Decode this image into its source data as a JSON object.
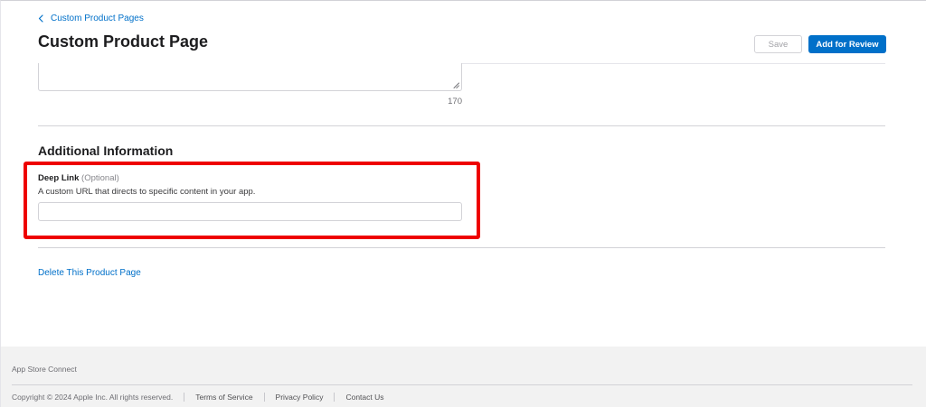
{
  "breadcrumb": {
    "back_label": "Custom Product Pages"
  },
  "header": {
    "title": "Custom Product Page",
    "save_label": "Save",
    "review_label": "Add for Review"
  },
  "promo_text": {
    "char_count": "170"
  },
  "additional_info": {
    "title": "Additional Information",
    "deep_link": {
      "label": "Deep Link",
      "optional": "(Optional)",
      "description": "A custom URL that directs to specific content in your app.",
      "value": "",
      "placeholder": ""
    }
  },
  "delete_link": "Delete This Product Page",
  "footer": {
    "brand": "App Store Connect",
    "copyright": "Copyright © 2024 Apple Inc. All rights reserved.",
    "links": [
      "Terms of Service",
      "Privacy Policy",
      "Contact Us"
    ]
  },
  "colors": {
    "accent": "#0070c9",
    "highlight": "#ee0000",
    "footer_bg": "#f2f2f2"
  },
  "icons": {
    "back": "chevron-left-icon",
    "resize": "resize-handle-icon"
  }
}
